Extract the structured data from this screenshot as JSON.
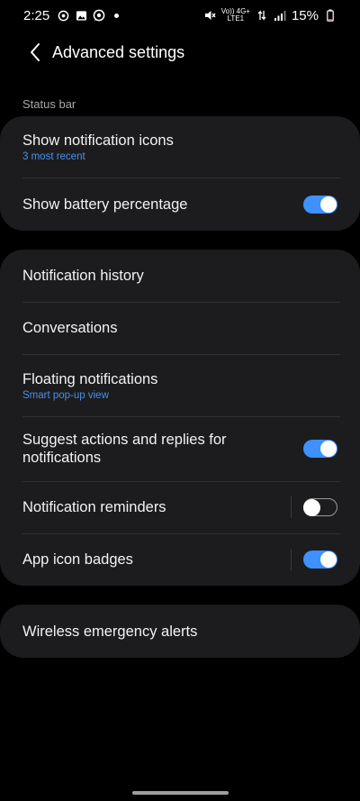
{
  "status_bar": {
    "time": "2:25",
    "network_line1": "Vo)) 4G+",
    "network_line2": "LTE1",
    "battery_text": "15%"
  },
  "header": {
    "title": "Advanced settings"
  },
  "status_bar_section": {
    "header": "Status bar",
    "items": [
      {
        "title": "Show notification icons",
        "subtitle": "3 most recent"
      },
      {
        "title": "Show battery percentage",
        "toggle": "on"
      }
    ]
  },
  "notifications_section": {
    "items": [
      {
        "title": "Notification history"
      },
      {
        "title": "Conversations"
      },
      {
        "title": "Floating notifications",
        "subtitle": "Smart pop-up view"
      },
      {
        "title": "Suggest actions and replies for notifications",
        "toggle": "on"
      },
      {
        "title": "Notification reminders",
        "toggle": "off"
      },
      {
        "title": "App icon badges",
        "toggle": "on"
      }
    ]
  },
  "alerts_section": {
    "items": [
      {
        "title": "Wireless emergency alerts"
      }
    ]
  },
  "colors": {
    "background": "#000000",
    "card": "#1c1c1e",
    "accent": "#3e91ff",
    "subtitle": "#4a8fe7"
  }
}
